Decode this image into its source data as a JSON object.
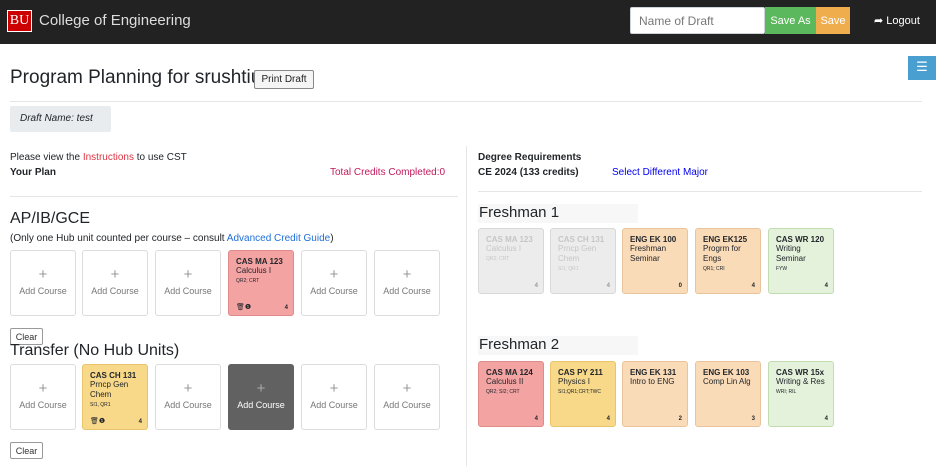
{
  "header": {
    "logo_text": "BU",
    "college": "College of Engineering",
    "draft_placeholder": "Name of Draft",
    "save_as": "Save As",
    "save": "Save",
    "logout": "Logout",
    "menu_icon": "☰"
  },
  "page": {
    "title": "Program Planning for srushtiu",
    "print_draft": "Print Draft",
    "draft_name": "Draft Name: test"
  },
  "left": {
    "instructions_prefix": "Please view the ",
    "instructions_link": "Instructions",
    "instructions_suffix": " to use CST",
    "your_plan": "Your Plan",
    "total_credits": "Total Credits Completed:0",
    "ap_title": "AP/IB/GCE",
    "ap_note": "(Only one Hub unit counted per course – consult ",
    "ap_note_link": "Advanced Credit Guide",
    "ap_note_end": ")",
    "add_course": "Add Course",
    "clear": "Clear",
    "transfer_title": "Transfer (No Hub Units)",
    "ap_course": {
      "code": "CAS MA 123",
      "name": "Calculus I",
      "hub": "QR2; CRT",
      "credits": "4",
      "icons": "🗑❶"
    },
    "transfer_course": {
      "code": "CAS CH 131",
      "name": "Prncp Gen Chem",
      "hub": "SI1, QR1",
      "credits": "4",
      "icons": "🗑❶"
    }
  },
  "right": {
    "degree_req": "Degree Requirements",
    "degree_name": "CE 2024 (133 credits)",
    "select_major": "Select Different Major",
    "freshman1": {
      "title": "Freshman 1",
      "courses": [
        {
          "code": "CAS MA 123",
          "name": "Calculus I",
          "hub": "QR2; CRT",
          "credits": "4"
        },
        {
          "code": "CAS CH 131",
          "name": "Prncp Gen Chem",
          "hub": "SI1; QR1",
          "credits": "4"
        },
        {
          "code": "ENG EK 100",
          "name": "Freshman Seminar",
          "hub": "",
          "credits": "0"
        },
        {
          "code": "ENG EK125",
          "name": "Progrm for Engs",
          "hub": "QR1; CRI",
          "credits": "4"
        },
        {
          "code": "CAS WR 120",
          "name": "Writing Seminar",
          "hub": "FYW",
          "credits": "4"
        }
      ]
    },
    "freshman2": {
      "title": "Freshman 2",
      "courses": [
        {
          "code": "CAS MA 124",
          "name": "Calculus II",
          "hub": "QR2; SI2; CRT",
          "credits": "4"
        },
        {
          "code": "CAS PY 211",
          "name": "Physics I",
          "hub": "SI1;QR1;CRT;TWC",
          "credits": "4"
        },
        {
          "code": "ENG EK 131",
          "name": "Intro to ENG",
          "hub": "",
          "credits": "2"
        },
        {
          "code": "ENG EK 103",
          "name": "Comp Lin Alg",
          "hub": "",
          "credits": "3"
        },
        {
          "code": "CAS WR 15x",
          "name": "Writing & Res",
          "hub": "WRI; RIL",
          "credits": "4"
        }
      ]
    }
  },
  "colors": {
    "red": "#f4a3a3",
    "yellow": "#f8d98a",
    "peach": "#fadbb8",
    "green": "#e4f2dc",
    "grey": "#ececec"
  }
}
